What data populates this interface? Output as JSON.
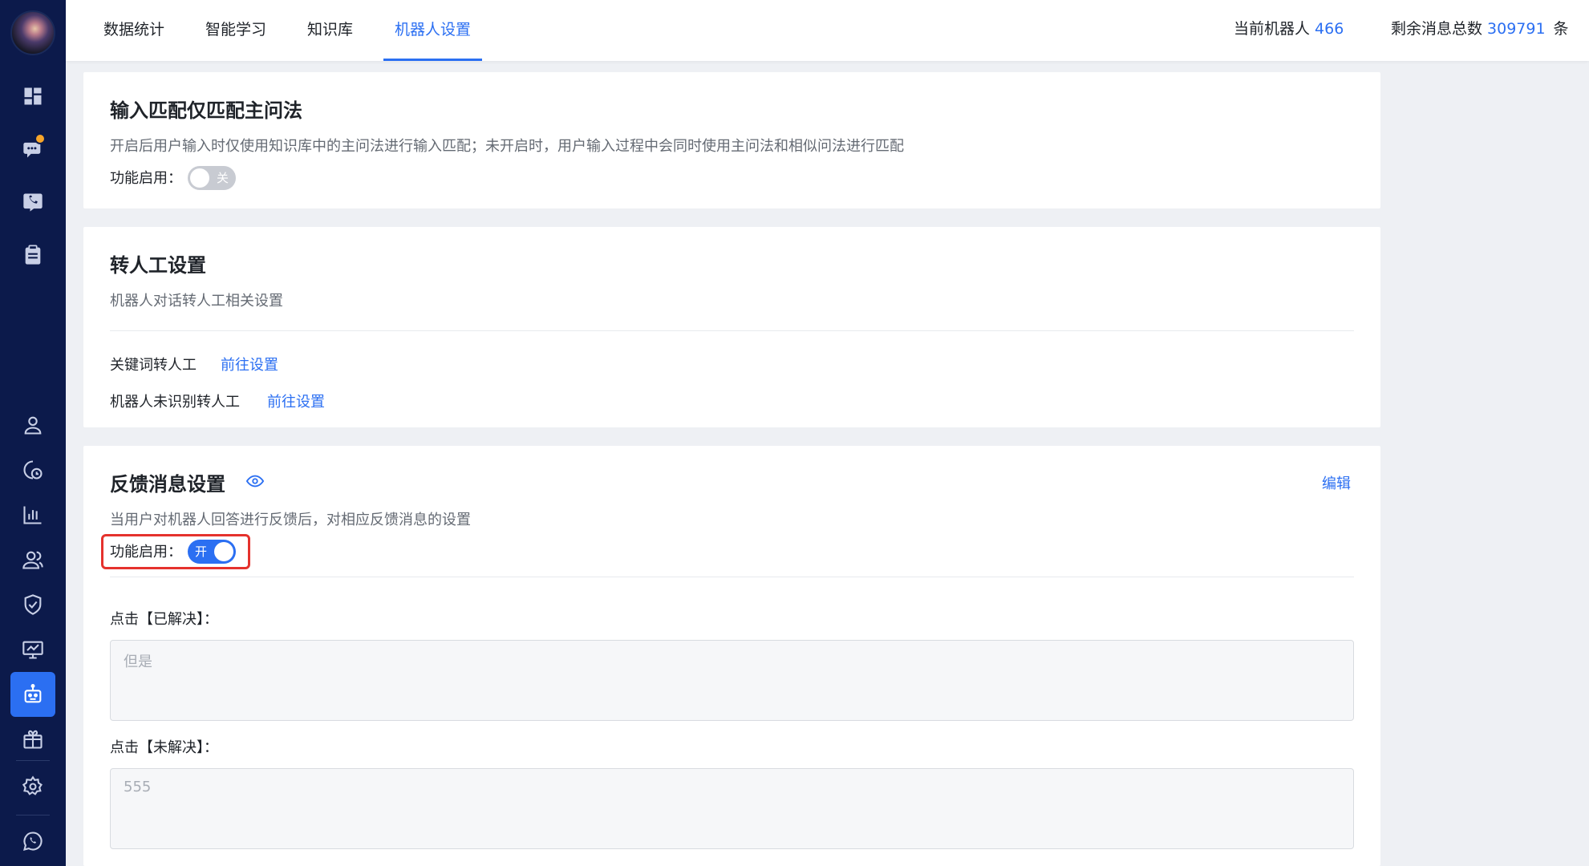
{
  "nav": {
    "tabs": [
      "数据统计",
      "智能学习",
      "知识库",
      "机器人设置"
    ],
    "active_tab": "机器人设置"
  },
  "header": {
    "robot_label": "当前机器人",
    "robot_id": "466",
    "msg_label": "剩余消息总数",
    "msg_count": "309791",
    "msg_unit": "条"
  },
  "card_match": {
    "title": "输入匹配仅匹配主问法",
    "desc": "开启后用户输入时仅使用知识库中的主问法进行输入匹配；未开启时，用户输入过程中会同时使用主问法和相似问法进行匹配",
    "enable_label": "功能启用：",
    "switch_text": "关",
    "enabled": false
  },
  "card_transfer": {
    "title": "转人工设置",
    "desc": "机器人对话转人工相关设置",
    "keyword_label": "关键词转人工",
    "keyword_link": "前往设置",
    "unrecognized_label": "机器人未识别转人工",
    "unrecognized_link": "前往设置"
  },
  "card_feedback": {
    "title": "反馈消息设置",
    "edit_label": "编辑",
    "desc": "当用户对机器人回答进行反馈后，对相应反馈消息的设置",
    "enable_label": "功能启用：",
    "switch_text": "开",
    "enabled": true,
    "resolved_label": "点击【已解决】：",
    "resolved_value": "但是",
    "unresolved_label": "点击【未解决】：",
    "unresolved_value": "555"
  },
  "colors": {
    "accent": "#2b6ff2",
    "sidebar": "#0c1a4b",
    "highlight": "#e5322d"
  }
}
